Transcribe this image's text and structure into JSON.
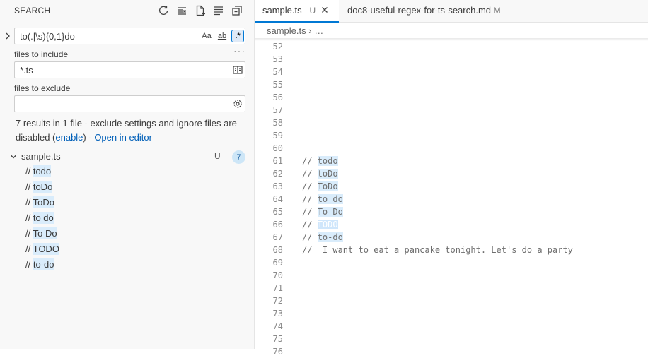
{
  "sidebar": {
    "title": "SEARCH",
    "search": {
      "value": "to(.|\\s){0,1}do",
      "case_label": "Aa",
      "word_label": "ab",
      "regex_label": ".*"
    },
    "include": {
      "label": "files to include",
      "value": "*.ts"
    },
    "exclude": {
      "label": "files to exclude",
      "value": ""
    },
    "message": {
      "prefix": "7 results in 1 file - exclude settings and ignore files are disabled (",
      "enable_link": "enable",
      "mid": ") - ",
      "open_link": "Open in editor"
    },
    "file": {
      "name": "sample.ts",
      "status": "U",
      "count": "7"
    },
    "matches": [
      {
        "prefix": "// ",
        "text": "todo"
      },
      {
        "prefix": "// ",
        "text": "toDo"
      },
      {
        "prefix": "// ",
        "text": "ToDo"
      },
      {
        "prefix": "// ",
        "text": "to do"
      },
      {
        "prefix": "// ",
        "text": "To Do"
      },
      {
        "prefix": "// ",
        "text": "TODO"
      },
      {
        "prefix": "// ",
        "text": "to-do"
      }
    ]
  },
  "tabs": [
    {
      "name": "sample.ts",
      "status": "U"
    },
    {
      "name": "doc8-useful-regex-for-ts-search.md",
      "status": "M"
    }
  ],
  "breadcrumb": {
    "file": "sample.ts",
    "rest": "…"
  },
  "code_lines": [
    {
      "n": "52",
      "pre": "",
      "match": "",
      "post": ""
    },
    {
      "n": "53",
      "pre": "",
      "match": "",
      "post": ""
    },
    {
      "n": "54",
      "pre": "",
      "match": "",
      "post": ""
    },
    {
      "n": "55",
      "pre": "",
      "match": "",
      "post": ""
    },
    {
      "n": "56",
      "pre": "",
      "match": "",
      "post": ""
    },
    {
      "n": "57",
      "pre": "",
      "match": "",
      "post": ""
    },
    {
      "n": "58",
      "pre": "",
      "match": "",
      "post": ""
    },
    {
      "n": "59",
      "pre": "",
      "match": "",
      "post": ""
    },
    {
      "n": "60",
      "pre": "",
      "match": "",
      "post": ""
    },
    {
      "n": "61",
      "pre": "// ",
      "match": "todo",
      "post": ""
    },
    {
      "n": "62",
      "pre": "// ",
      "match": "toDo",
      "post": ""
    },
    {
      "n": "63",
      "pre": "// ",
      "match": "ToDo",
      "post": ""
    },
    {
      "n": "64",
      "pre": "// ",
      "match": "to do",
      "post": ""
    },
    {
      "n": "65",
      "pre": "// ",
      "match": "To Do",
      "post": ""
    },
    {
      "n": "66",
      "pre": "// ",
      "match": "TODO",
      "post": "",
      "selected": true
    },
    {
      "n": "67",
      "pre": "// ",
      "match": "to-do",
      "post": ""
    },
    {
      "n": "68",
      "pre": "//  I want to eat a pancake tonight. Let's do a party",
      "match": "",
      "post": ""
    },
    {
      "n": "69",
      "pre": "",
      "match": "",
      "post": ""
    },
    {
      "n": "70",
      "pre": "",
      "match": "",
      "post": ""
    },
    {
      "n": "71",
      "pre": "",
      "match": "",
      "post": ""
    },
    {
      "n": "72",
      "pre": "",
      "match": "",
      "post": ""
    },
    {
      "n": "73",
      "pre": "",
      "match": "",
      "post": ""
    },
    {
      "n": "74",
      "pre": "",
      "match": "",
      "post": ""
    },
    {
      "n": "75",
      "pre": "",
      "match": "",
      "post": ""
    },
    {
      "n": "76",
      "pre": "",
      "match": "",
      "post": ""
    }
  ]
}
